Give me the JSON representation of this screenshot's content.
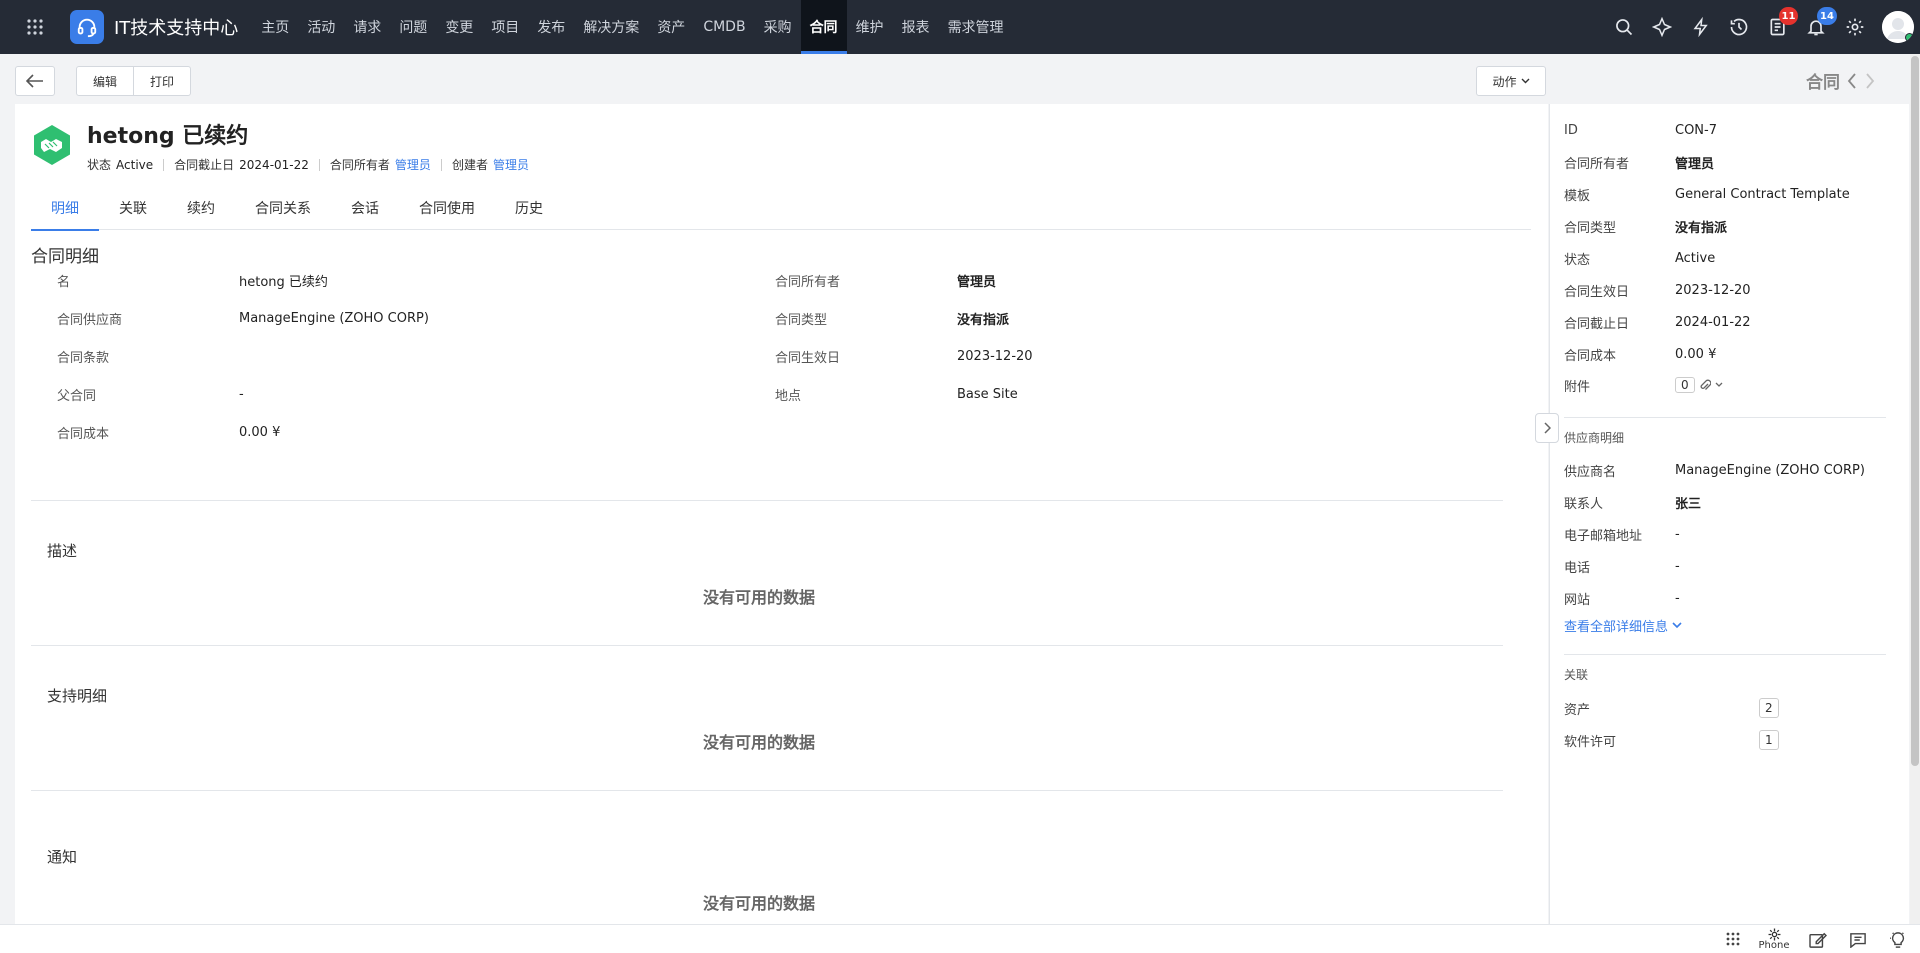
{
  "app": {
    "title": "IT技术支持中心",
    "nav_tabs": [
      {
        "label": "主页"
      },
      {
        "label": "活动"
      },
      {
        "label": "请求"
      },
      {
        "label": "问题"
      },
      {
        "label": "变更"
      },
      {
        "label": "项目"
      },
      {
        "label": "发布"
      },
      {
        "label": "解决方案"
      },
      {
        "label": "资产"
      },
      {
        "label": "CMDB"
      },
      {
        "label": "采购"
      },
      {
        "label": "合同",
        "active": true
      },
      {
        "label": "维护"
      },
      {
        "label": "报表"
      },
      {
        "label": "需求管理"
      }
    ],
    "badges": {
      "tasks": "11",
      "notifications": "14"
    }
  },
  "toolbar": {
    "edit_label": "编辑",
    "print_label": "打印",
    "action_label": "动作",
    "module_label": "合同"
  },
  "record": {
    "title": "hetong 已续约",
    "meta": {
      "status_key": "状态",
      "status_value": "Active",
      "expiry_key": "合同截止日",
      "expiry_value": "2024-01-22",
      "owner_key": "合同所有者",
      "owner_value": "管理员",
      "creator_key": "创建者",
      "creator_value": "管理员"
    },
    "tabs": [
      "明细",
      "关联",
      "续约",
      "合同关系",
      "会话",
      "合同使用",
      "历史"
    ],
    "section_title": "合同明细",
    "left_fields": [
      {
        "key": "名",
        "value": "hetong 已续约"
      },
      {
        "key": "合同供应商",
        "value": "ManageEngine (ZOHO CORP)"
      },
      {
        "key": "合同条款",
        "value": ""
      },
      {
        "key": "父合同",
        "value": "-"
      },
      {
        "key": "合同成本",
        "value": "0.00 ¥"
      }
    ],
    "right_fields": [
      {
        "key": "合同所有者",
        "value": "管理员"
      },
      {
        "key": "合同类型",
        "value": "没有指派"
      },
      {
        "key": "合同生效日",
        "value": "2023-12-20"
      },
      {
        "key": "地点",
        "value": "Base Site"
      }
    ],
    "subsections": [
      {
        "title": "描述",
        "empty": "没有可用的数据"
      },
      {
        "title": "支持明细",
        "empty": "没有可用的数据"
      },
      {
        "title": "通知",
        "empty": "没有可用的数据"
      }
    ]
  },
  "side": {
    "info": [
      {
        "key": "ID",
        "value": "CON-7"
      },
      {
        "key": "合同所有者",
        "value": "管理员"
      },
      {
        "key": "模板",
        "value": "General Contract Template"
      },
      {
        "key": "合同类型",
        "value": "没有指派"
      },
      {
        "key": "状态",
        "value": "Active"
      },
      {
        "key": "合同生效日",
        "value": "2023-12-20"
      },
      {
        "key": "合同截止日",
        "value": "2024-01-22"
      },
      {
        "key": "合同成本",
        "value": "0.00 ¥"
      }
    ],
    "attachment_key": "附件",
    "attachment_count": "0",
    "vendor_section": "供应商明细",
    "vendor": [
      {
        "key": "供应商名",
        "value": "ManageEngine (ZOHO CORP)"
      },
      {
        "key": "联系人",
        "value": "张三"
      },
      {
        "key": "电子邮箱地址",
        "value": "-"
      },
      {
        "key": "电话",
        "value": "-"
      },
      {
        "key": "网站",
        "value": "-"
      }
    ],
    "view_all": "查看全部详细信息",
    "assoc_section": "关联",
    "assoc": [
      {
        "key": "资产",
        "count": "2"
      },
      {
        "key": "软件许可",
        "count": "1"
      }
    ]
  },
  "bottom": {
    "phone_label": "Phone"
  },
  "colors": {
    "accent": "#3a7de8",
    "nav_bg": "#252b36",
    "record_icon": "#2fbf71",
    "badge_red": "#e5322d"
  }
}
